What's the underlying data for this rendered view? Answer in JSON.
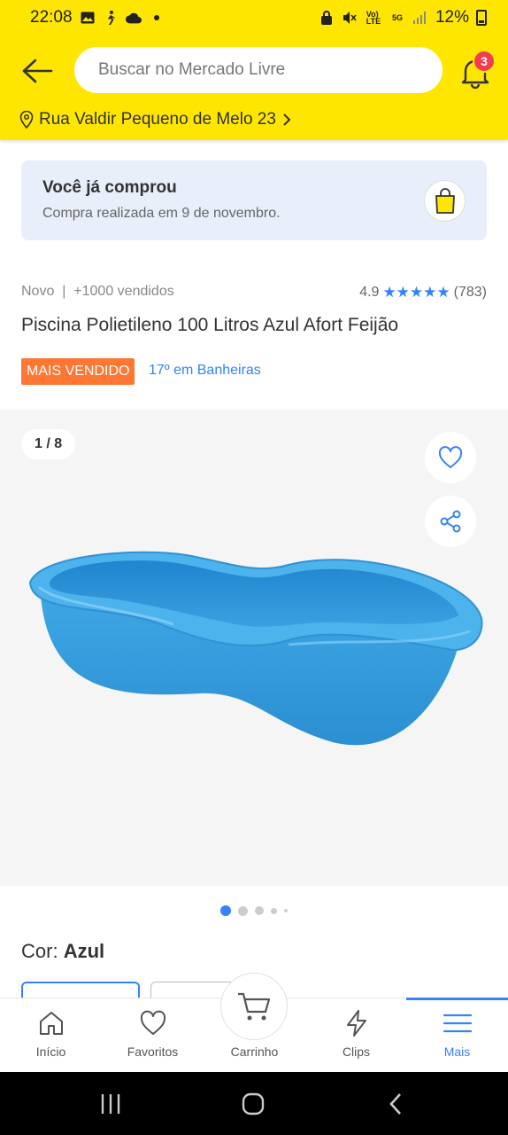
{
  "status_bar": {
    "time": "22:08",
    "battery": "12%"
  },
  "header": {
    "search_placeholder": "Buscar no Mercado Livre",
    "notification_count": "3",
    "address": "Rua Valdir Pequeno de Melo 23"
  },
  "purchase_notice": {
    "title": "Você já comprou",
    "subtitle": "Compra realizada em 9 de novembro."
  },
  "product": {
    "condition_sold": "Novo  |  +1000 vendidos",
    "rating": "4.9",
    "stars": 5,
    "reviews": "(783)",
    "title": "Piscina Polietileno 100 Litros Azul Afort Feijão",
    "tag": "MAIS VENDIDO",
    "ranking": "17º em Banheiras",
    "image_counter": "1 / 8",
    "color_label": "Cor: ",
    "color_value": "Azul"
  },
  "bottom_nav": [
    {
      "label": "Início",
      "icon": "home-icon"
    },
    {
      "label": "Favoritos",
      "icon": "heart-icon"
    },
    {
      "label": "Carrinho",
      "icon": "cart-icon"
    },
    {
      "label": "Clips",
      "icon": "lightning-icon"
    },
    {
      "label": "Mais",
      "icon": "menu-icon",
      "active": true
    }
  ],
  "colors": {
    "brand_yellow": "#ffe600",
    "accent_blue": "#3483fa",
    "tag_orange": "#ff7733",
    "badge_red": "#f23d4f"
  }
}
